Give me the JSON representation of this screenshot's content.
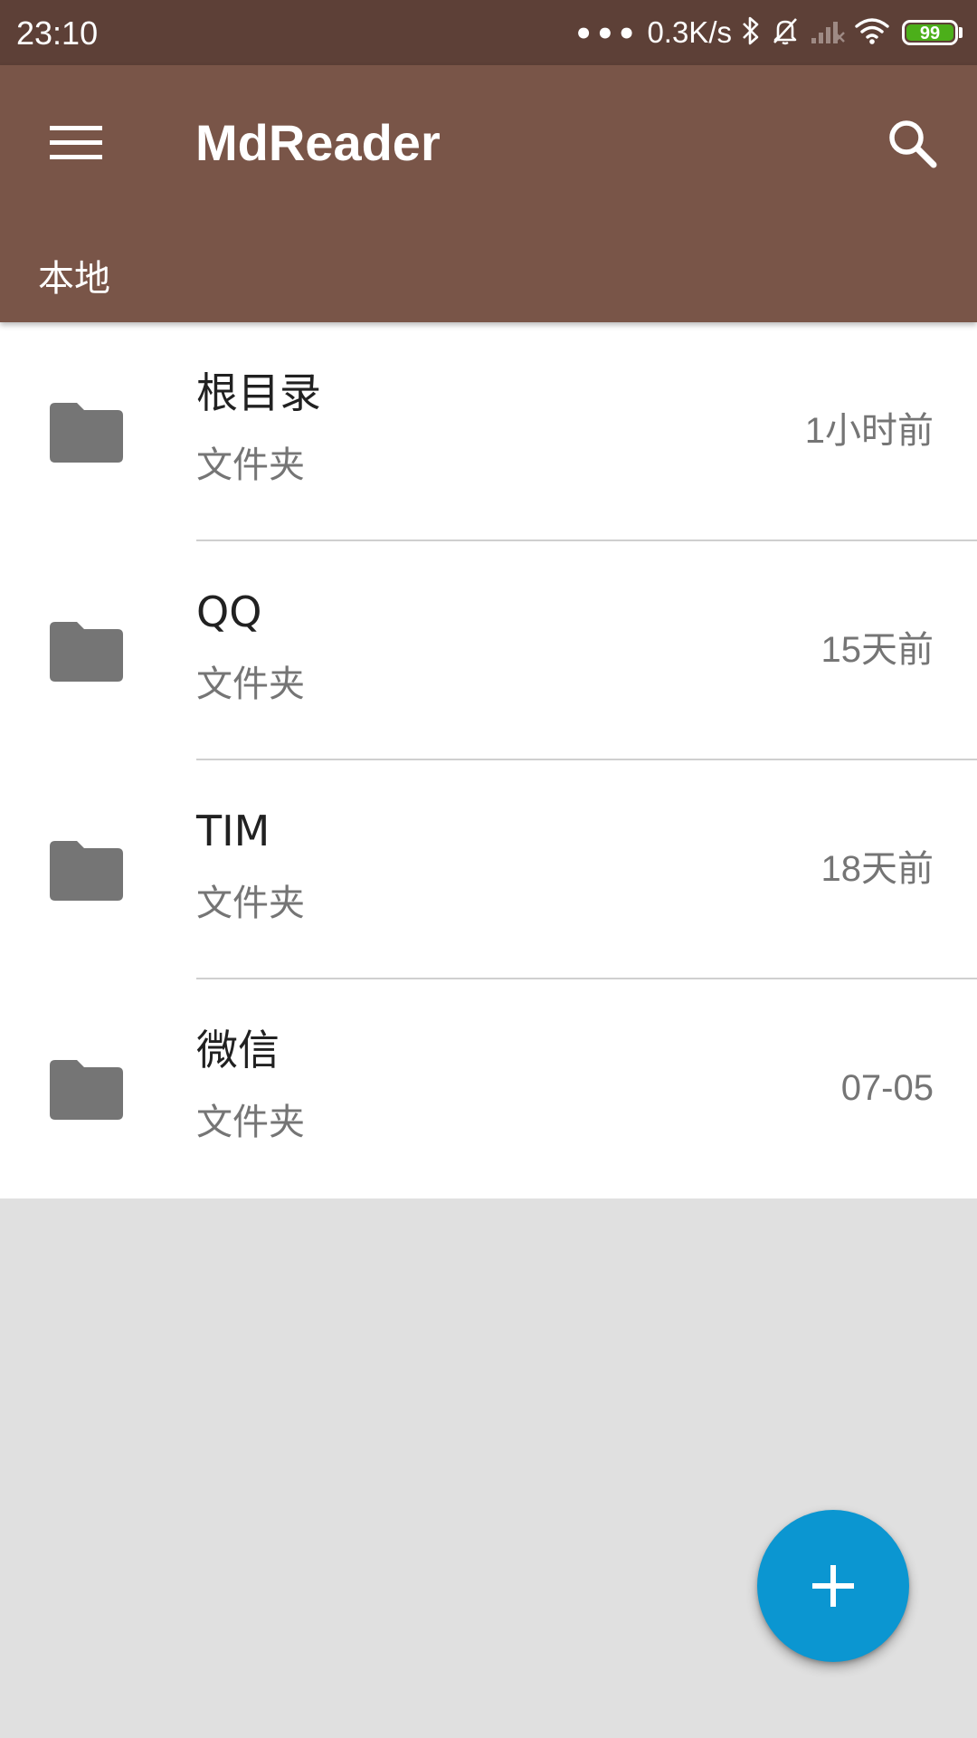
{
  "status_bar": {
    "time": "23:10",
    "more": "•••",
    "net_speed": "0.3K/s",
    "battery_level": "99",
    "battery_color": "#4caf1a",
    "icons": [
      "bluetooth-icon",
      "mute-bell-icon",
      "signal-icon",
      "wifi-icon",
      "battery-icon"
    ]
  },
  "app_bar": {
    "title": "MdReader",
    "menu_icon": "menu-icon",
    "search_icon": "search-icon",
    "tab_label": "本地",
    "color": "#795548",
    "status_color": "#5d4037"
  },
  "files": [
    {
      "name": "根目录",
      "type": "文件夹",
      "time": "1小时前",
      "icon": "folder-icon"
    },
    {
      "name": "QQ",
      "type": "文件夹",
      "time": "15天前",
      "icon": "folder-icon"
    },
    {
      "name": "TIM",
      "type": "文件夹",
      "time": "18天前",
      "icon": "folder-icon"
    },
    {
      "name": "微信",
      "type": "文件夹",
      "time": "07-05",
      "icon": "folder-icon"
    }
  ],
  "fab": {
    "icon": "plus-icon",
    "color": "#0b96d1"
  }
}
